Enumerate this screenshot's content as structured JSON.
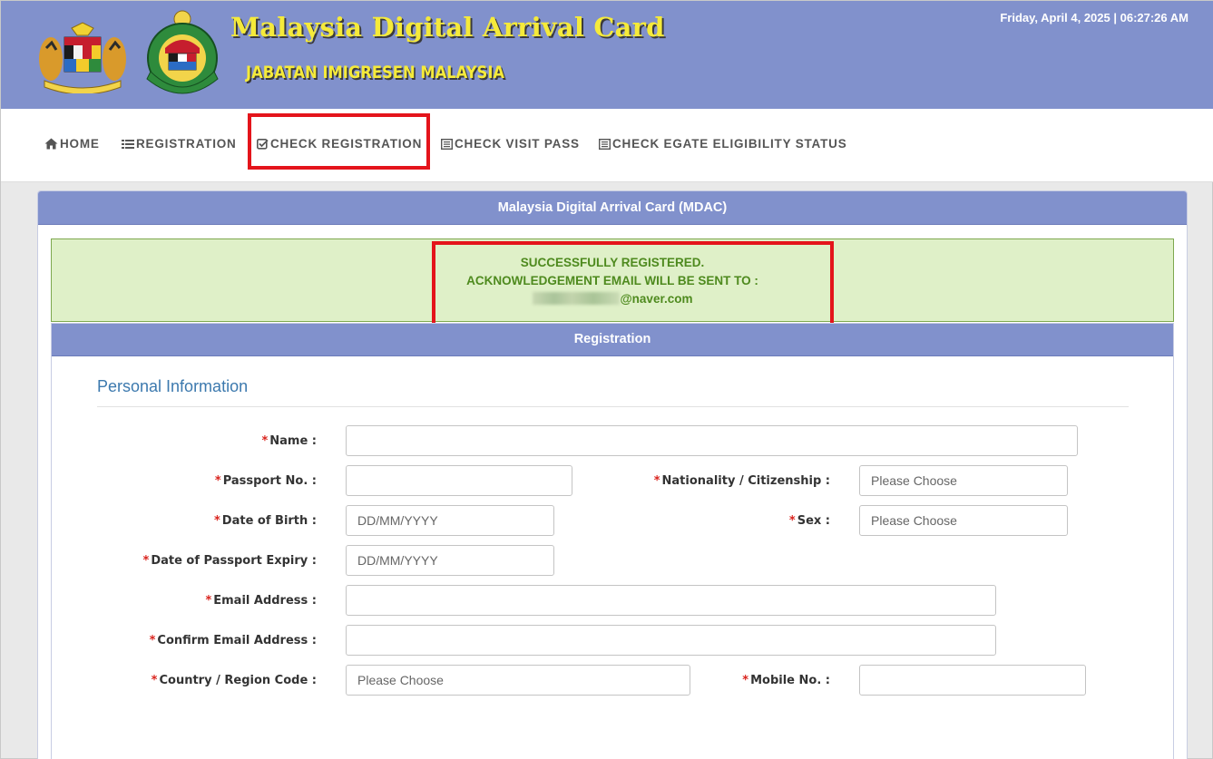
{
  "header": {
    "title": "Malaysia Digital Arrival Card",
    "subtitle": "JABATAN IMIGRESEN MALAYSIA",
    "datetime": "Friday, April 4, 2025 | 06:27:26 AM"
  },
  "nav": {
    "items": [
      {
        "label": "HOME",
        "icon": "home-icon"
      },
      {
        "label": "REGISTRATION",
        "icon": "list-icon"
      },
      {
        "label": "CHECK REGISTRATION",
        "icon": "check-square-icon"
      },
      {
        "label": "CHECK VISIT PASS",
        "icon": "document-icon"
      },
      {
        "label": "CHECK EGATE ELIGIBILITY STATUS",
        "icon": "document-icon"
      }
    ]
  },
  "panel": {
    "title": "Malaysia Digital Arrival Card (MDAC)"
  },
  "alert": {
    "line1": "SUCCESSFULLY REGISTERED.",
    "line2": "ACKNOWLEDGEMENT EMAIL WILL BE SENT TO :",
    "email_domain": "@naver.com"
  },
  "registration": {
    "title": "Registration",
    "section": "Personal Information",
    "fields": {
      "name": {
        "label": "Name :",
        "value": ""
      },
      "passport_no": {
        "label": "Passport No. :",
        "value": ""
      },
      "nationality": {
        "label": "Nationality / Citizenship :",
        "value": "Please Choose"
      },
      "dob": {
        "label": "Date of Birth :",
        "placeholder": "DD/MM/YYYY"
      },
      "sex": {
        "label": "Sex :",
        "value": "Please Choose"
      },
      "passport_expiry": {
        "label": "Date of Passport Expiry :",
        "placeholder": "DD/MM/YYYY"
      },
      "email": {
        "label": "Email Address :",
        "value": ""
      },
      "confirm_email": {
        "label": "Confirm Email Address :",
        "value": ""
      },
      "country_code": {
        "label": "Country / Region Code :",
        "value": "Please Choose"
      },
      "mobile": {
        "label": "Mobile No. :",
        "value": ""
      }
    }
  },
  "colors": {
    "header_bg": "#8191cc",
    "title_yellow": "#f5ea3a",
    "highlight_red": "#e4141b",
    "success_bg": "#dff0c8",
    "success_text": "#4e8a1e",
    "required_star": "#d9231d",
    "section_blue": "#3c79ae"
  }
}
